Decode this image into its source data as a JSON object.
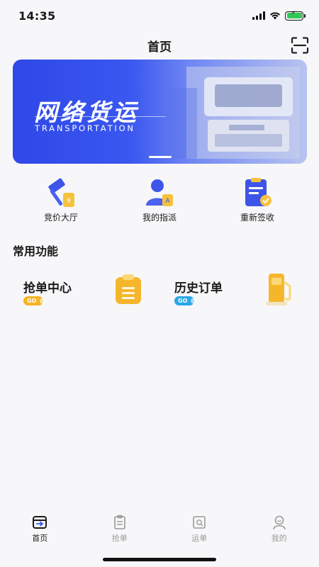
{
  "status_bar": {
    "time": "14:35",
    "icons": [
      "signal-icon",
      "wifi-icon",
      "battery-charging-icon"
    ]
  },
  "nav": {
    "title": "首页",
    "scan_icon": "scan-icon"
  },
  "banner": {
    "title": "网络货运",
    "subtitle": "TRANSPORTATION"
  },
  "quick_entries": [
    {
      "label": "竞价大厅",
      "icon": "auction-hammer-icon"
    },
    {
      "label": "我的指派",
      "icon": "user-assign-icon"
    },
    {
      "label": "重新签收",
      "icon": "sign-document-icon"
    }
  ],
  "section": {
    "title": "常用功能"
  },
  "functions": [
    {
      "label": "抢单中心",
      "badge": "GO",
      "icon": "clipboard-icon",
      "badge_color": "#f5b324"
    },
    {
      "label": "历史订单",
      "badge": "GO",
      "icon": "fuel-pump-icon",
      "badge_color": "#29a7e6"
    }
  ],
  "tabs": [
    {
      "label": "首页",
      "icon": "home-card-icon",
      "active": true
    },
    {
      "label": "抢单",
      "icon": "clipboard-tab-icon",
      "active": false
    },
    {
      "label": "运单",
      "icon": "waybill-search-icon",
      "active": false
    },
    {
      "label": "我的",
      "icon": "profile-icon",
      "active": false
    }
  ],
  "colors": {
    "accent": "#3a57ef",
    "active_tab": "#1a1a1a",
    "inactive_tab": "#9a9a9a"
  }
}
